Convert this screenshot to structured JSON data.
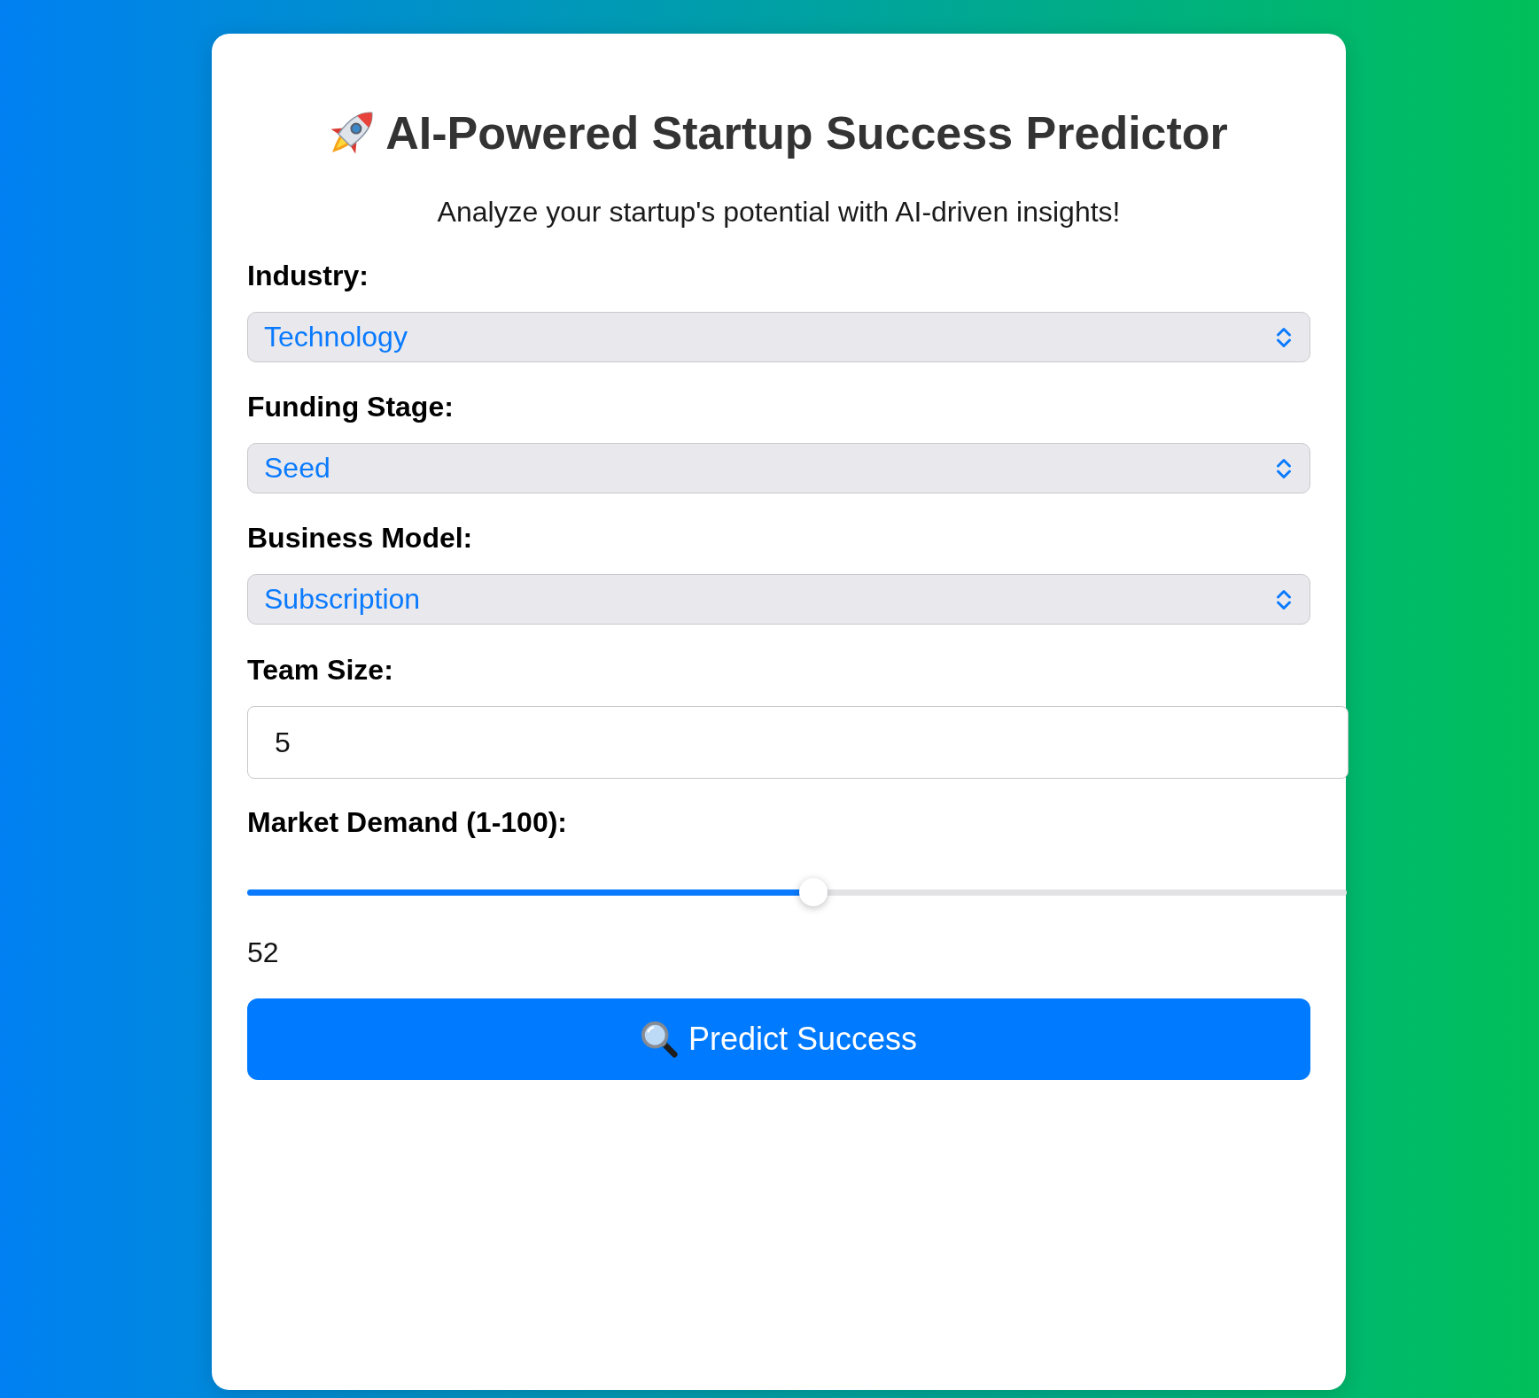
{
  "title": "AI-Powered Startup Success Predictor",
  "subtitle": "Analyze your startup's potential with AI-driven insights!",
  "fields": [
    {
      "kind": "select",
      "label": "Industry:",
      "value": "Technology"
    },
    {
      "kind": "select",
      "label": "Funding Stage:",
      "value": "Seed"
    },
    {
      "kind": "select",
      "label": "Business Model:",
      "value": "Subscription"
    },
    {
      "kind": "number",
      "label": "Team Size:",
      "value": "5"
    },
    {
      "kind": "slider",
      "label": "Market Demand (1-100):",
      "level": 0.515,
      "reading": "52"
    }
  ],
  "button": {
    "label": "Predict Success"
  }
}
